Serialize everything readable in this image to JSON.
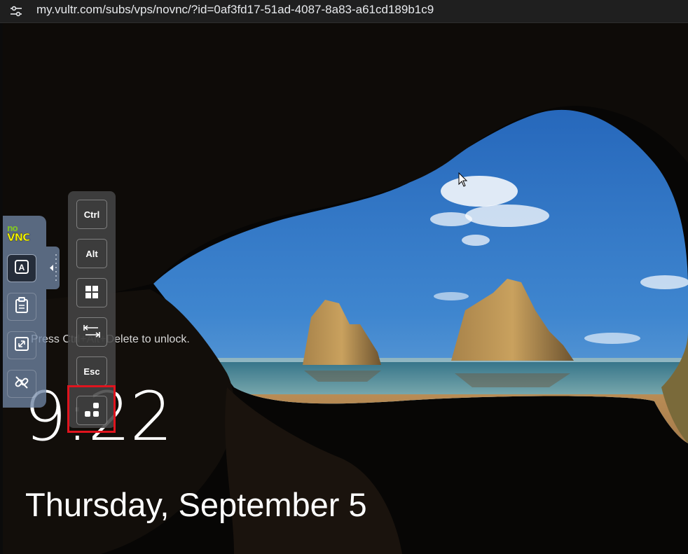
{
  "browser": {
    "url": "my.vultr.com/subs/vps/novnc/?id=0af3fd17-51ad-4087-8a83-a61cd189b1c9"
  },
  "lockscreen": {
    "unlock_hint": "Press Ctrl+Alt+Delete to unlock.",
    "time": "9:22",
    "date": "Thursday, September 5"
  },
  "novnc": {
    "logo_no": "no",
    "logo_vnc": "VNC",
    "buttons": [
      {
        "icon": "keyboard-a-icon",
        "active": true
      },
      {
        "icon": "clipboard-icon"
      },
      {
        "icon": "fullscreen-icon"
      },
      {
        "icon": "disconnect-icon"
      }
    ]
  },
  "extra_keys": {
    "ctrl": "Ctrl",
    "alt": "Alt",
    "windows": "windows-icon",
    "tab": "tab-icon",
    "esc": "Esc",
    "ctrl_alt_del": "ctrl-alt-del-icon"
  },
  "colors": {
    "highlight": "#e0141e",
    "novnc_bar": "#6e84a3",
    "keys_panel": "#444444"
  }
}
